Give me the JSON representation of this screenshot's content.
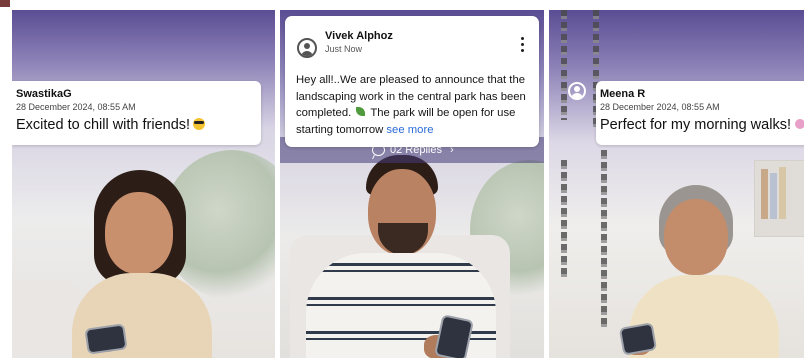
{
  "panels": [
    {
      "user": "SwastikaG",
      "date": "28 December 2024, 08:55 AM",
      "message": "Excited to chill with friends!",
      "emoji": "sunglasses-emoji"
    },
    {
      "user": "Vivek Alphoz",
      "time": "Just Now",
      "body_main": "Hey all!..We are pleased to announce that the landscaping work in the central park has been completed.",
      "body_rest": "The park will be open for use starting tomorrow",
      "see_more": "see more",
      "replies": "02 Replies",
      "emoji": "seedling-emoji"
    },
    {
      "user": "Meena R",
      "date": "28 December 2024, 08:55 AM",
      "message": "Perfect for my morning walks!",
      "emoji": "blossom-emoji"
    }
  ],
  "icons": {
    "avatar": "user-circle-icon",
    "more": "more-vertical-icon",
    "replies": "chat-bubble-icon",
    "chevron": "chevron-right-icon"
  },
  "colors": {
    "banner_purple": "#5b4d93",
    "link_blue": "#2b6cd8",
    "card_bg": "#ffffff"
  }
}
